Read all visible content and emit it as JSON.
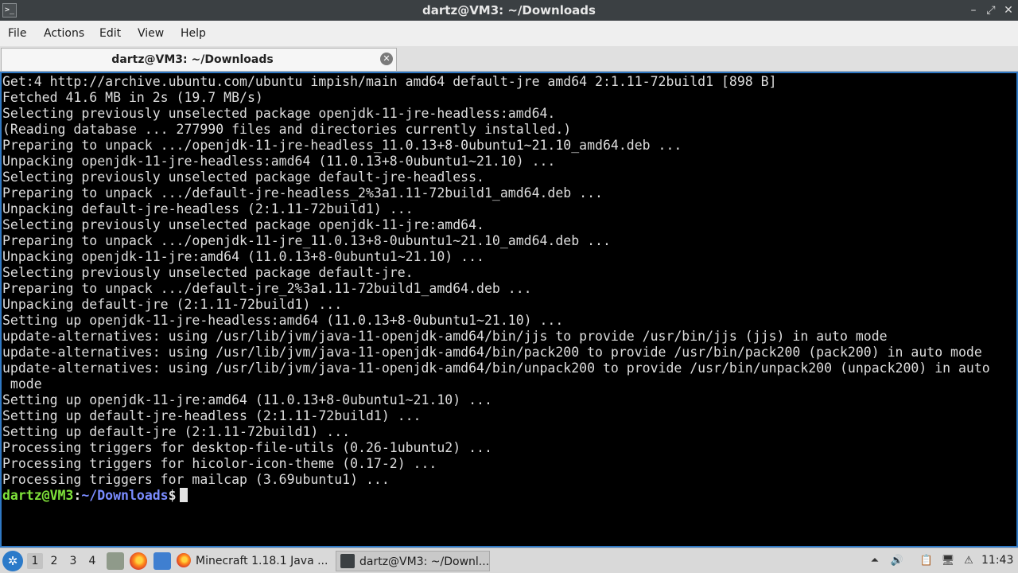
{
  "window": {
    "title": "dartz@VM3: ~/Downloads",
    "minimize_glyph": "–",
    "maximize_glyph": "⤢",
    "close_glyph": "✕"
  },
  "menu": [
    "File",
    "Actions",
    "Edit",
    "View",
    "Help"
  ],
  "tab": {
    "label": "dartz@VM3: ~/Downloads",
    "close_glyph": "✕"
  },
  "terminal": {
    "lines": [
      "Get:4 http://archive.ubuntu.com/ubuntu impish/main amd64 default-jre amd64 2:1.11-72build1 [898 B]",
      "Fetched 41.6 MB in 2s (19.7 MB/s)",
      "Selecting previously unselected package openjdk-11-jre-headless:amd64.",
      "(Reading database ... 277990 files and directories currently installed.)",
      "Preparing to unpack .../openjdk-11-jre-headless_11.0.13+8-0ubuntu1~21.10_amd64.deb ...",
      "Unpacking openjdk-11-jre-headless:amd64 (11.0.13+8-0ubuntu1~21.10) ...",
      "Selecting previously unselected package default-jre-headless.",
      "Preparing to unpack .../default-jre-headless_2%3a1.11-72build1_amd64.deb ...",
      "Unpacking default-jre-headless (2:1.11-72build1) ...",
      "Selecting previously unselected package openjdk-11-jre:amd64.",
      "Preparing to unpack .../openjdk-11-jre_11.0.13+8-0ubuntu1~21.10_amd64.deb ...",
      "Unpacking openjdk-11-jre:amd64 (11.0.13+8-0ubuntu1~21.10) ...",
      "Selecting previously unselected package default-jre.",
      "Preparing to unpack .../default-jre_2%3a1.11-72build1_amd64.deb ...",
      "Unpacking default-jre (2:1.11-72build1) ...",
      "Setting up openjdk-11-jre-headless:amd64 (11.0.13+8-0ubuntu1~21.10) ...",
      "update-alternatives: using /usr/lib/jvm/java-11-openjdk-amd64/bin/jjs to provide /usr/bin/jjs (jjs) in auto mode",
      "update-alternatives: using /usr/lib/jvm/java-11-openjdk-amd64/bin/pack200 to provide /usr/bin/pack200 (pack200) in auto mode",
      "update-alternatives: using /usr/lib/jvm/java-11-openjdk-amd64/bin/unpack200 to provide /usr/bin/unpack200 (unpack200) in auto",
      " mode",
      "Setting up openjdk-11-jre:amd64 (11.0.13+8-0ubuntu1~21.10) ...",
      "Setting up default-jre-headless (2:1.11-72build1) ...",
      "Setting up default-jre (2:1.11-72build1) ...",
      "Processing triggers for desktop-file-utils (0.26-1ubuntu2) ...",
      "Processing triggers for hicolor-icon-theme (0.17-2) ...",
      "Processing triggers for mailcap (3.69ubuntu1) ..."
    ],
    "prompt": {
      "user": "dartz@VM3",
      "colon": ":",
      "path": "~/Downloads",
      "dollar": "$"
    }
  },
  "taskbar": {
    "workspaces": [
      "1",
      "2",
      "3",
      "4"
    ],
    "active_workspace": "1",
    "tasks": [
      "Minecraft 1.18.1 Java ...",
      "dartz@VM3: ~/Downl..."
    ],
    "clock": "11:43"
  },
  "colors": {
    "terminal_bg": "#000000",
    "terminal_fg": "#dedede",
    "prompt_user": "#7fe23a",
    "prompt_path": "#7a8cff",
    "focus_border": "#2f78c4"
  }
}
